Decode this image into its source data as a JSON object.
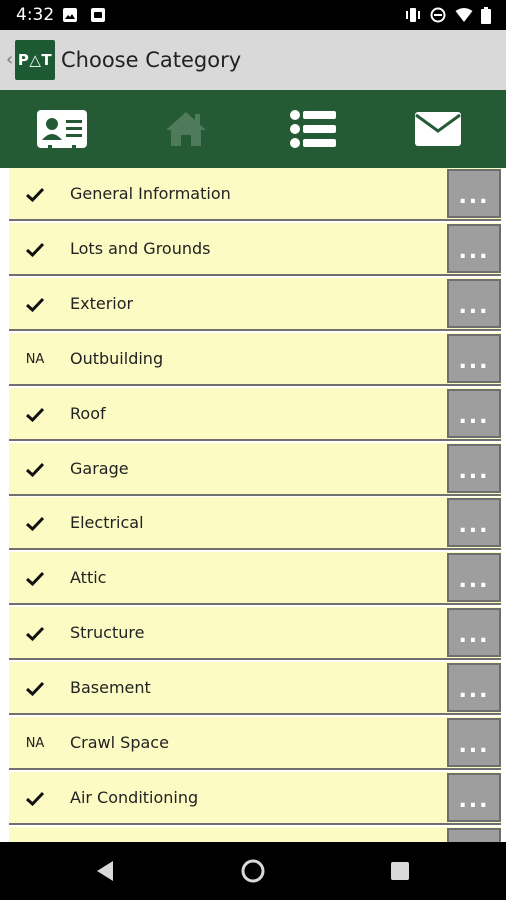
{
  "status_bar": {
    "time": "4:32",
    "icons": [
      "photo-icon",
      "android-icon",
      "vibrate-icon",
      "do-not-disturb-icon",
      "wifi-icon",
      "battery-icon"
    ]
  },
  "app_bar": {
    "back_glyph": "‹",
    "logo_text": "P△T",
    "title": "Choose Category"
  },
  "toolbar": {
    "buttons": [
      "contact-card-icon",
      "home-icon",
      "list-icon",
      "mail-icon"
    ]
  },
  "colors": {
    "toolbar_bg": "#245b34",
    "row_bg": "#fdfbc4",
    "more_bg": "#9e9e9e",
    "disabled_icon": "#4f7a5c"
  },
  "categories": [
    {
      "status": "check",
      "label": "General Information"
    },
    {
      "status": "check",
      "label": "Lots and Grounds"
    },
    {
      "status": "check",
      "label": "Exterior"
    },
    {
      "status": "NA",
      "label": "Outbuilding"
    },
    {
      "status": "check",
      "label": "Roof"
    },
    {
      "status": "check",
      "label": "Garage"
    },
    {
      "status": "check",
      "label": "Electrical"
    },
    {
      "status": "check",
      "label": "Attic"
    },
    {
      "status": "check",
      "label": "Structure"
    },
    {
      "status": "check",
      "label": "Basement"
    },
    {
      "status": "NA",
      "label": "Crawl Space"
    },
    {
      "status": "check",
      "label": "Air Conditioning"
    }
  ],
  "more_label": "...",
  "na_label": "NA"
}
